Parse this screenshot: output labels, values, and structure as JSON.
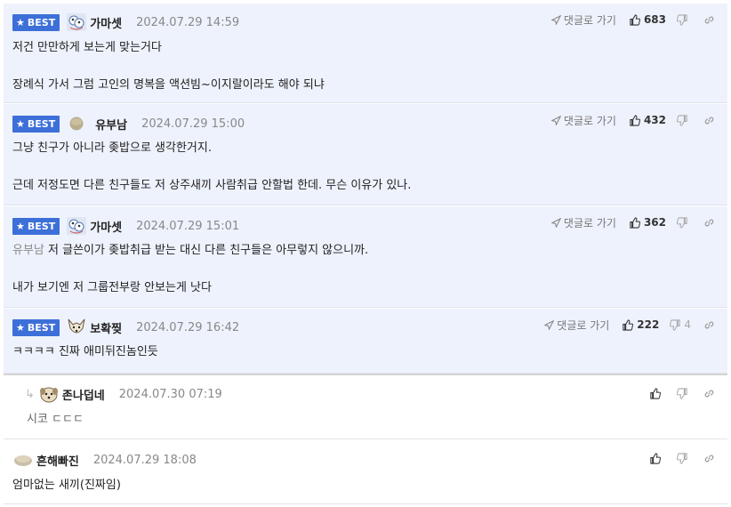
{
  "comments": [
    {
      "badge": "BEST",
      "nick": "가마셋",
      "date": "2024.07.29 14:59",
      "goto": "댓글로 가기",
      "likes": "683",
      "dislikes": "",
      "lines": [
        "저건 만만하게 보는게 맞는거다",
        "장례식 가서 그럼 고인의 명복을 액션빔~이지랄이라도 해야 되냐"
      ]
    },
    {
      "badge": "BEST",
      "nick": "유부남",
      "date": "2024.07.29 15:00",
      "goto": "댓글로 가기",
      "likes": "432",
      "dislikes": "",
      "lines": [
        "그냥 친구가 아니라 좆밥으로 생각한거지.",
        "근데 저정도면 다른 친구들도 저 상주새끼 사람취급 안할법 한데. 무슨 이유가 있나."
      ]
    },
    {
      "badge": "BEST",
      "nick": "가마셋",
      "date": "2024.07.29 15:01",
      "goto": "댓글로 가기",
      "likes": "362",
      "dislikes": "",
      "mention": "유부남",
      "lines": [
        "저 글쓴이가 좆밥취급 받는 대신 다른 친구들은 아무렇지 않으니까.",
        "내가 보기엔 저 그룹전부랑 안보는게 낫다"
      ]
    },
    {
      "badge": "BEST",
      "nick": "보확찢",
      "date": "2024.07.29 16:42",
      "goto": "댓글로 가기",
      "likes": "222",
      "dislikes": "4",
      "lines": [
        "ㅋㅋㅋㅋ 진짜 애미뒤진놈인듯"
      ]
    },
    {
      "nick": "존나덥네",
      "date": "2024.07.30 07:19",
      "likes": "",
      "dislikes": "",
      "lines": [
        "시코 ㄷㄷㄷ"
      ]
    },
    {
      "nick": "흔해빠진",
      "date": "2024.07.29 18:08",
      "likes": "",
      "dislikes": "",
      "lines": [
        "엄마없는 새끼(진짜임)"
      ]
    }
  ],
  "icons": [
    "star-icon",
    "paper-plane-icon",
    "thumbs-up-icon",
    "thumbs-down-icon",
    "link-icon",
    "reply-arrow-icon"
  ],
  "colors": {
    "best_bg": "#eef2fc",
    "badge": "#3d6fd9",
    "muted": "#888888"
  }
}
